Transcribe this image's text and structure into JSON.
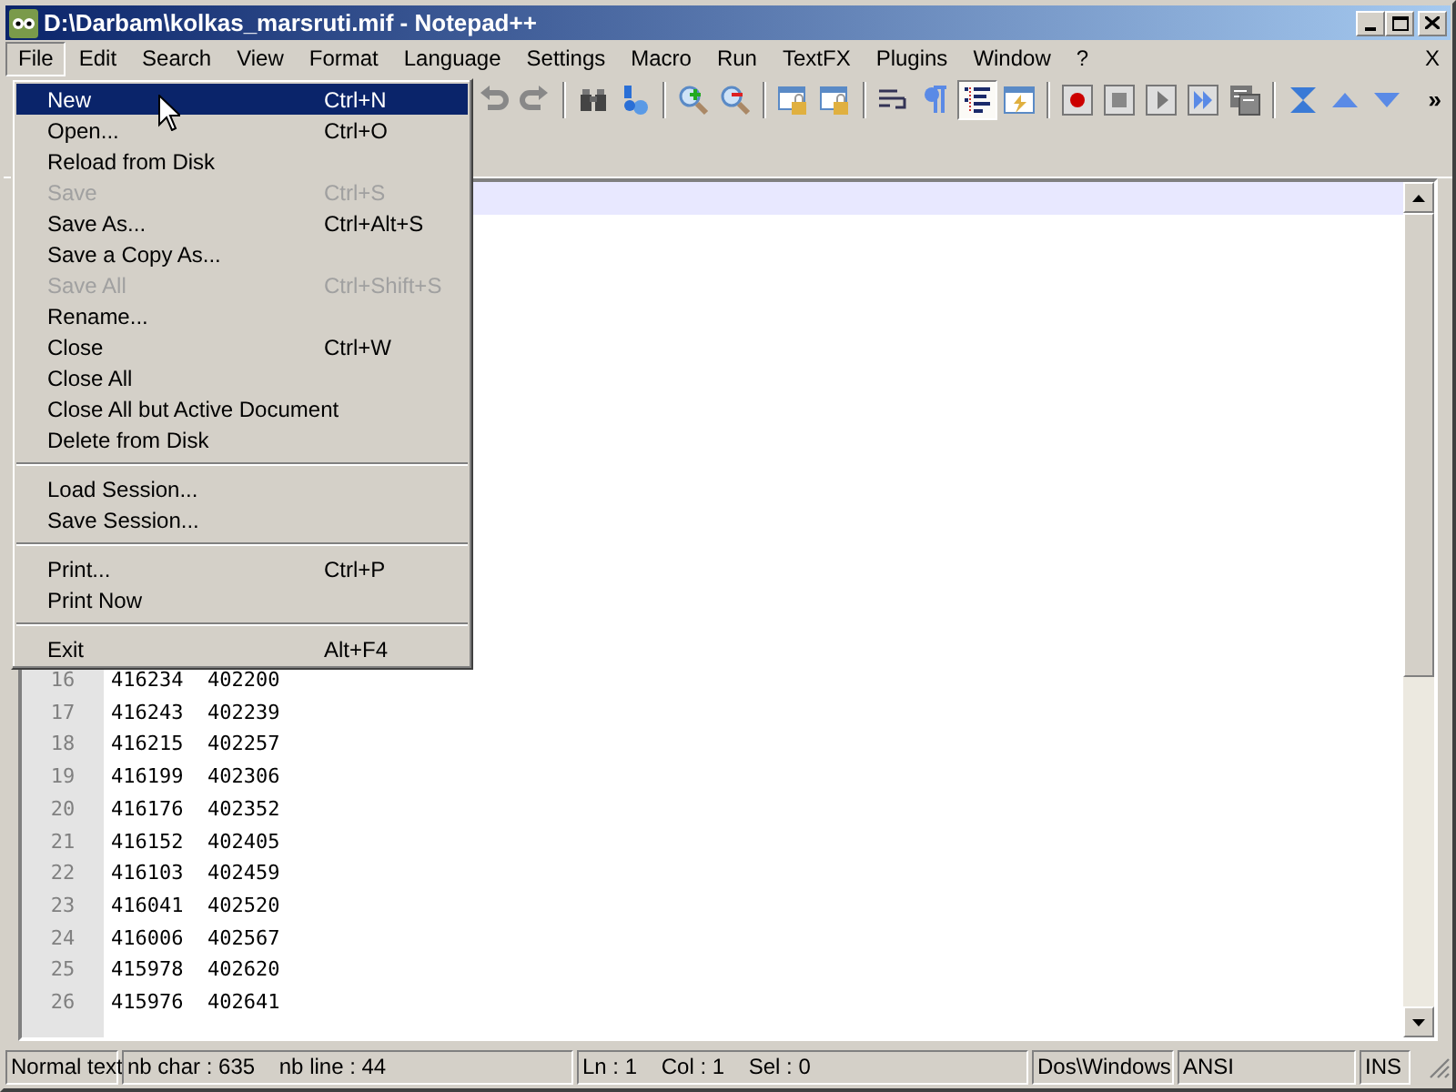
{
  "window": {
    "title": "D:\\Darbam\\kolkas_marsruti.mif - Notepad++"
  },
  "menu_bar": [
    {
      "label": "File",
      "selected": true
    },
    {
      "label": "Edit",
      "selected": false
    },
    {
      "label": "Search",
      "selected": false
    },
    {
      "label": "View",
      "selected": false
    },
    {
      "label": "Format",
      "selected": false
    },
    {
      "label": "Language",
      "selected": false
    },
    {
      "label": "Settings",
      "selected": false
    },
    {
      "label": "Macro",
      "selected": false
    },
    {
      "label": "Run",
      "selected": false
    },
    {
      "label": "TextFX",
      "selected": false
    },
    {
      "label": "Plugins",
      "selected": false
    },
    {
      "label": "Window",
      "selected": false
    },
    {
      "label": "?",
      "selected": false
    }
  ],
  "close_document": "X",
  "toolbar": [
    {
      "kind": "undo",
      "selected": false
    },
    {
      "kind": "redo",
      "selected": false
    },
    {
      "kind": "sep"
    },
    {
      "kind": "find",
      "selected": false
    },
    {
      "kind": "replace",
      "selected": false
    },
    {
      "kind": "sep"
    },
    {
      "kind": "zoomin",
      "selected": false
    },
    {
      "kind": "zoomout",
      "selected": false
    },
    {
      "kind": "sep"
    },
    {
      "kind": "syncv",
      "selected": false
    },
    {
      "kind": "synch",
      "selected": false
    },
    {
      "kind": "sep"
    },
    {
      "kind": "wrap",
      "selected": false
    },
    {
      "kind": "pilcrow",
      "selected": false
    },
    {
      "kind": "indent",
      "selected": true
    },
    {
      "kind": "userlang",
      "selected": false
    },
    {
      "kind": "sep"
    },
    {
      "kind": "record",
      "selected": false
    },
    {
      "kind": "stop",
      "selected": false
    },
    {
      "kind": "play",
      "selected": false
    },
    {
      "kind": "playmulti",
      "selected": false
    },
    {
      "kind": "savemacro",
      "selected": false
    },
    {
      "kind": "sep"
    },
    {
      "kind": "collapse",
      "selected": false
    },
    {
      "kind": "up",
      "selected": false
    },
    {
      "kind": "down",
      "selected": false
    }
  ],
  "toolbar_more": "»",
  "file_menu": [
    {
      "kind": "item",
      "label": "New",
      "shortcut": "Ctrl+N",
      "selected": true,
      "disabled": false
    },
    {
      "kind": "item",
      "label": "Open...",
      "shortcut": "Ctrl+O",
      "selected": false,
      "disabled": false
    },
    {
      "kind": "item",
      "label": "Reload from Disk",
      "selected": false,
      "disabled": false
    },
    {
      "kind": "item",
      "label": "Save",
      "shortcut": "Ctrl+S",
      "selected": false,
      "disabled": true
    },
    {
      "kind": "item",
      "label": "Save As...",
      "shortcut": "Ctrl+Alt+S",
      "selected": false,
      "disabled": false
    },
    {
      "kind": "item",
      "label": "Save a Copy As...",
      "selected": false,
      "disabled": false
    },
    {
      "kind": "item",
      "label": "Save All",
      "shortcut": "Ctrl+Shift+S",
      "selected": false,
      "disabled": true
    },
    {
      "kind": "item",
      "label": "Rename...",
      "selected": false,
      "disabled": false
    },
    {
      "kind": "item",
      "label": "Close",
      "shortcut": "Ctrl+W",
      "selected": false,
      "disabled": false
    },
    {
      "kind": "item",
      "label": "Close All",
      "selected": false,
      "disabled": false
    },
    {
      "kind": "item",
      "label": "Close All but Active Document",
      "selected": false,
      "disabled": false
    },
    {
      "kind": "item",
      "label": "Delete from Disk",
      "selected": false,
      "disabled": false
    },
    {
      "kind": "separator"
    },
    {
      "kind": "item",
      "label": "Load Session...",
      "selected": false,
      "disabled": false
    },
    {
      "kind": "item",
      "label": "Save Session...",
      "selected": false,
      "disabled": false
    },
    {
      "kind": "separator"
    },
    {
      "kind": "item",
      "label": "Print...",
      "shortcut": "Ctrl+P",
      "selected": false,
      "disabled": false
    },
    {
      "kind": "item",
      "label": "Print Now",
      "selected": false,
      "disabled": false
    },
    {
      "kind": "separator"
    },
    {
      "kind": "item",
      "label": "Exit",
      "shortcut": "Alt+F4",
      "selected": false,
      "disabled": false
    }
  ],
  "editor": {
    "lines": [
      {
        "number": "16",
        "text": "416234  402200"
      },
      {
        "number": "17",
        "text": "416243  402239"
      },
      {
        "number": "18",
        "text": "416215  402257"
      },
      {
        "number": "19",
        "text": "416199  402306"
      },
      {
        "number": "20",
        "text": "416176  402352"
      },
      {
        "number": "21",
        "text": "416152  402405"
      },
      {
        "number": "22",
        "text": "416103  402459"
      },
      {
        "number": "23",
        "text": "416041  402520"
      },
      {
        "number": "24",
        "text": "416006  402567"
      },
      {
        "number": "25",
        "text": "415978  402620"
      },
      {
        "number": "26",
        "text": "415976  402641"
      }
    ]
  },
  "status_bar": [
    "Normal text",
    "nb char : 635    nb line : 44",
    "Ln : 1    Col : 1    Sel : 0",
    "Dos\\Windows",
    "ANSI",
    "INS"
  ]
}
